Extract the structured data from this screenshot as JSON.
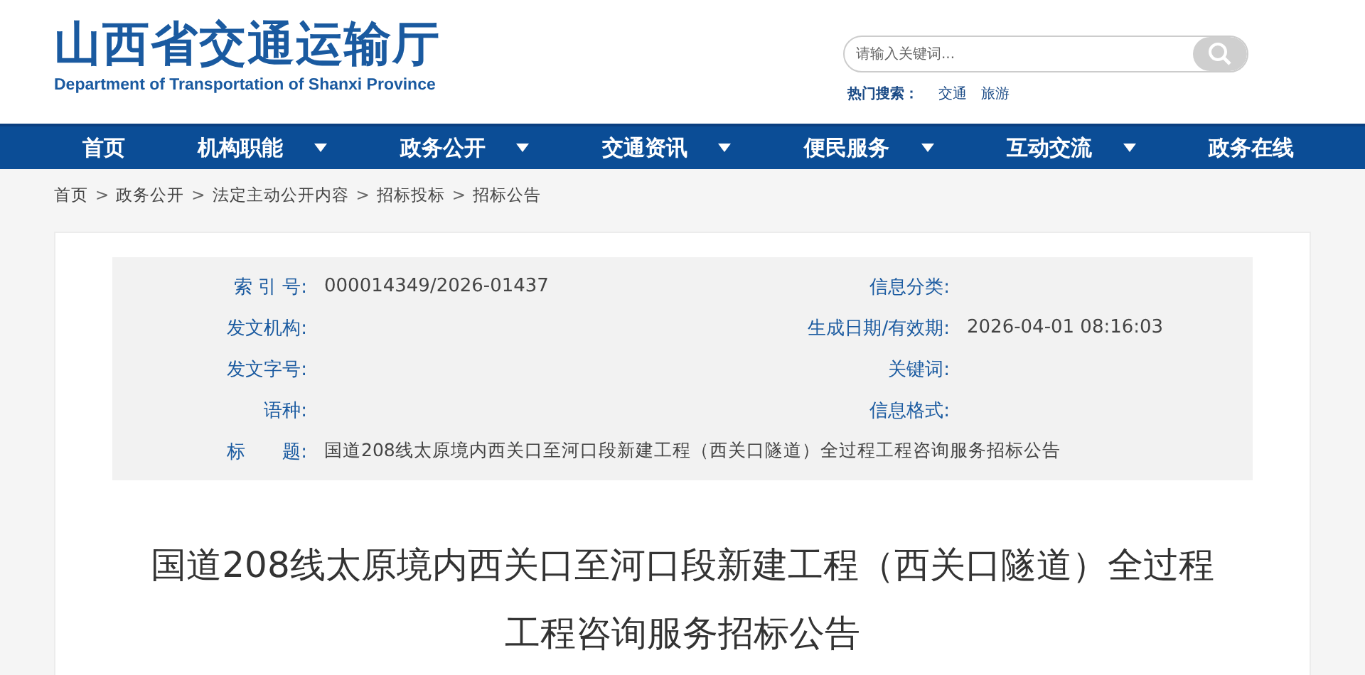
{
  "header": {
    "title": "山西省交通运输厅",
    "subtitle": "Department of Transportation of Shanxi Province",
    "search": {
      "placeholder": "请输入关键词..."
    },
    "hot_search": {
      "label": "热门搜索：",
      "links": [
        "交通",
        "旅游"
      ]
    }
  },
  "nav": [
    {
      "label": "首页",
      "dropdown": false
    },
    {
      "label": "机构职能",
      "dropdown": true
    },
    {
      "label": "政务公开",
      "dropdown": true
    },
    {
      "label": "交通资讯",
      "dropdown": true
    },
    {
      "label": "便民服务",
      "dropdown": true
    },
    {
      "label": "互动交流",
      "dropdown": true
    },
    {
      "label": "政务在线",
      "dropdown": false
    }
  ],
  "breadcrumb": {
    "separator": ">",
    "items": [
      "首页",
      "政务公开",
      "法定主动公开内容",
      "招标投标",
      "招标公告"
    ]
  },
  "info": {
    "rows": [
      {
        "label": "索 引 号:",
        "value": "000014349/2026-01437",
        "label_2": "信息分类:"
      },
      {
        "label": "发文机构:",
        "label_2": "生成日期/有效期:",
        "value_2": "2026-04-01 08:16:03"
      },
      {
        "label": "发文字号:",
        "label_2": "关键词:"
      },
      {
        "label": "语种:",
        "label_2": "信息格式:"
      }
    ],
    "title_label": "标　　题:",
    "title_value": "国道208线太原境内西关口至河口段新建工程（西关口隧道）全过程工程咨询服务招标公告"
  },
  "article_title": "国道208线太原境内西关口至河口段新建工程（西关口隧道）全过程工程咨询服务招标公告"
}
